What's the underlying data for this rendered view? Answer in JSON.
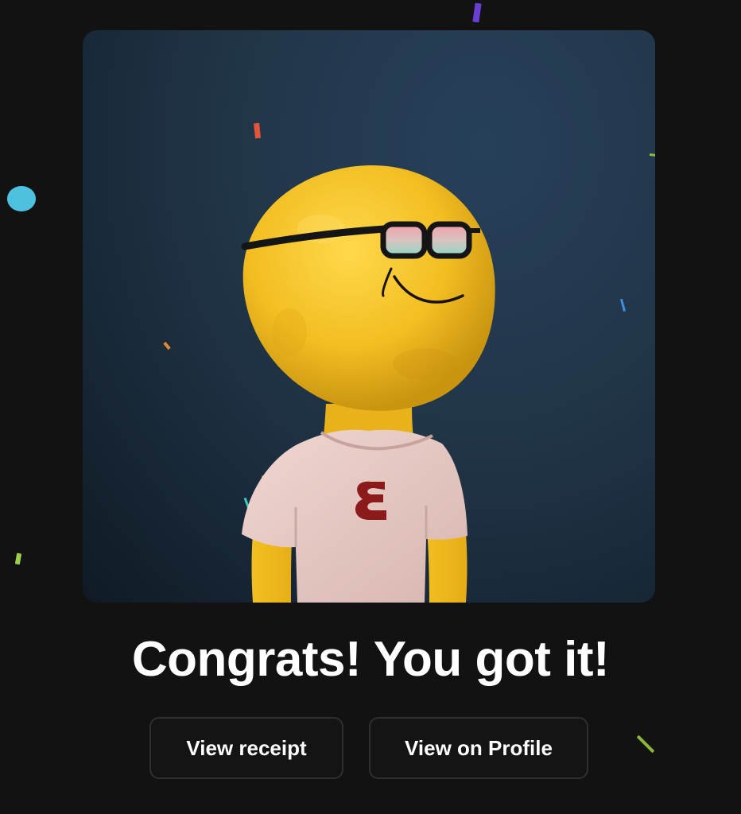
{
  "celebration": {
    "headline": "Congrats! You got it!",
    "artwork_icon": "clay-yellow-smiley-character-with-glasses-and-tshirt",
    "shirt_logo": "Ɛ"
  },
  "actions": {
    "view_receipt_label": "View receipt",
    "view_on_profile_label": "View on Profile"
  },
  "colors": {
    "page_background": "#121212",
    "artwork_background": "#213548",
    "button_background": "#141414",
    "button_border": "#2f2f33",
    "text": "#ffffff",
    "character_yellow": "#f5c12a",
    "shirt_pink": "#e6c9c4",
    "logo_red": "#8b1a1a"
  }
}
